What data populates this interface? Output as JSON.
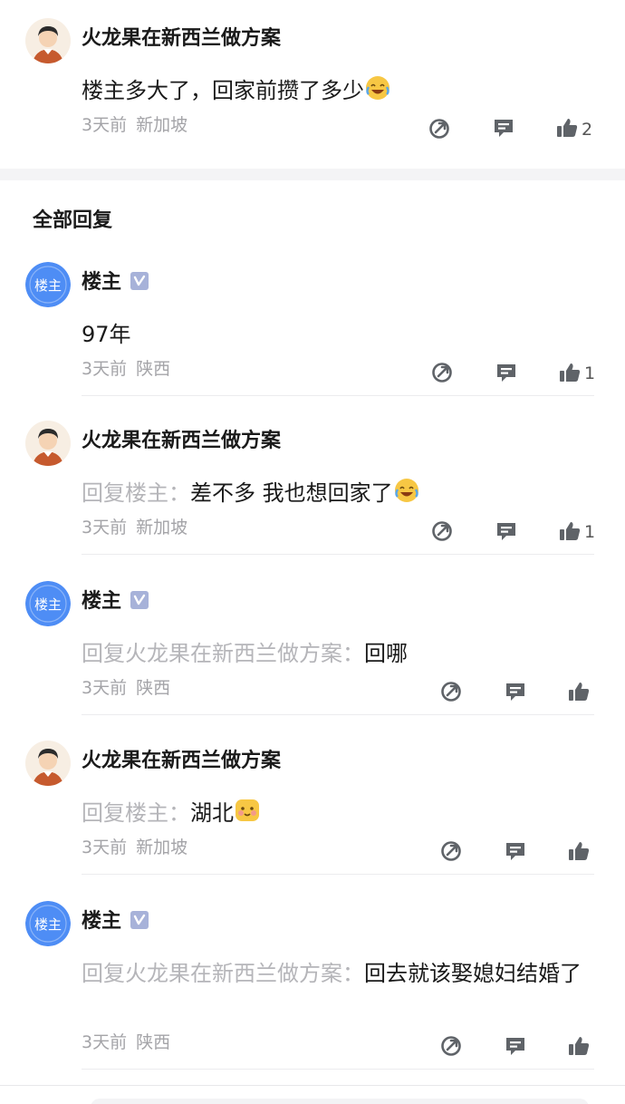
{
  "top_comment": {
    "name": "火龙果在新西兰做方案",
    "text": "楼主多大了，回家前攒了多少",
    "emoji": "laugh-cry",
    "time": "3天前",
    "location": "新加坡",
    "likes": "2"
  },
  "section_title": "全部回复",
  "replies": [
    {
      "name": "楼主",
      "verified": true,
      "reply_prefix": "",
      "text": "97年",
      "emoji": "",
      "time": "3天前",
      "location": "陕西",
      "likes": "1"
    },
    {
      "name": "火龙果在新西兰做方案",
      "verified": false,
      "reply_prefix": "回复楼主：",
      "text": "差不多 我也想回家了",
      "emoji": "laugh-cry",
      "time": "3天前",
      "location": "新加坡",
      "likes": "1"
    },
    {
      "name": "楼主",
      "verified": true,
      "reply_prefix": "回复火龙果在新西兰做方案：",
      "text": "回哪",
      "emoji": "",
      "time": "3天前",
      "location": "陕西",
      "likes": ""
    },
    {
      "name": "火龙果在新西兰做方案",
      "verified": false,
      "reply_prefix": "回复楼主：",
      "text": "湖北",
      "emoji": "shy",
      "time": "3天前",
      "location": "新加坡",
      "likes": ""
    },
    {
      "name": "楼主",
      "verified": true,
      "reply_prefix": "回复火龙果在新西兰做方案：",
      "text": "回去就该娶媳妇结婚了",
      "emoji": "",
      "time": "3天前",
      "location": "陕西",
      "likes": ""
    }
  ],
  "avatar_label": "楼主",
  "colors": {
    "accent": "#4e8df5",
    "muted": "#a4a4a8",
    "reply_prefix": "#b5b5b9",
    "icon": "#5f6368"
  },
  "icons": [
    "share-icon",
    "comment-icon",
    "thumbs-up-icon",
    "verified-icon"
  ]
}
